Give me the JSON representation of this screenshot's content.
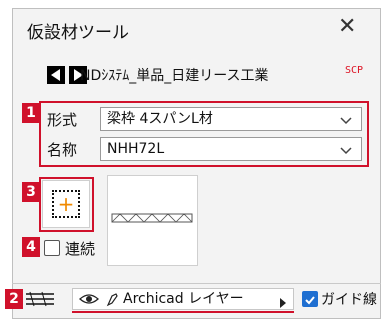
{
  "window": {
    "title": "仮設材ツール"
  },
  "nav": {
    "text": "NDｼｽﾃﾑ_単品_日建リース工業",
    "badge": "SCP"
  },
  "tags": {
    "t1": "1",
    "t2": "2",
    "t3": "3",
    "t4": "4"
  },
  "form": {
    "type_label": "形式",
    "type_value": "梁枠 4スパンL材",
    "name_label": "名称",
    "name_value": "NHH72L"
  },
  "options": {
    "continuous_label": "連続",
    "continuous_checked": false
  },
  "layer": {
    "value": "Archicad レイヤー"
  },
  "guide": {
    "label": "ガイド線",
    "checked": true
  },
  "colors": {
    "accent_red": "#d0112b",
    "check_blue": "#1f6fd1",
    "plus_orange": "#f08a00"
  }
}
